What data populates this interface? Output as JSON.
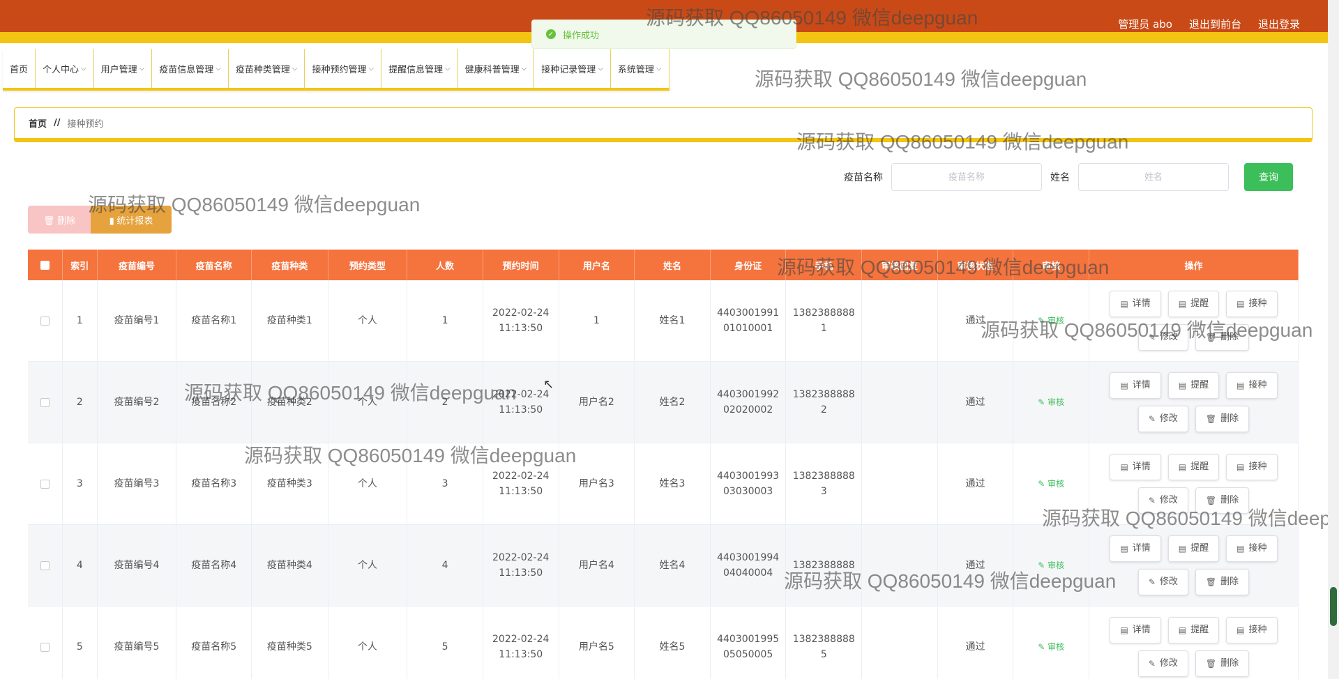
{
  "header": {
    "admin": "管理员 abo",
    "exit_front": "退出到前台",
    "logout": "退出登录"
  },
  "toast": {
    "message": "操作成功"
  },
  "nav": [
    {
      "label": "首页",
      "dropdown": false
    },
    {
      "label": "个人中心",
      "dropdown": true
    },
    {
      "label": "用户管理",
      "dropdown": true
    },
    {
      "label": "疫苗信息管理",
      "dropdown": true
    },
    {
      "label": "疫苗种类管理",
      "dropdown": true
    },
    {
      "label": "接种预约管理",
      "dropdown": true
    },
    {
      "label": "提醒信息管理",
      "dropdown": true
    },
    {
      "label": "健康科普管理",
      "dropdown": true
    },
    {
      "label": "接种记录管理",
      "dropdown": true
    },
    {
      "label": "系统管理",
      "dropdown": true
    }
  ],
  "breadcrumb": {
    "home": "首页",
    "sep": "//",
    "current": "接种预约"
  },
  "search": {
    "vaccine_label": "疫苗名称",
    "vaccine_placeholder": "疫苗名称",
    "name_label": "姓名",
    "name_placeholder": "姓名",
    "query": "查询"
  },
  "actions": {
    "delete": "删除",
    "report": "统计报表"
  },
  "table": {
    "headers": [
      "",
      "索引",
      "疫苗编号",
      "疫苗名称",
      "疫苗种类",
      "预约类型",
      "人数",
      "预约时间",
      "用户名",
      "姓名",
      "身份证",
      "手机",
      "审核回复",
      "审核状态",
      "审核",
      "操作"
    ],
    "rows": [
      {
        "idx": "1",
        "code": "疫苗编号1",
        "name": "疫苗名称1",
        "type": "疫苗种类1",
        "apptype": "个人",
        "count": "1",
        "time": "2022-02-24\n11:13:50",
        "user": "1",
        "realname": "姓名1",
        "idcard": "4403001991\n01010001",
        "phone": "1382388888\n1",
        "reply": "",
        "status": "通过",
        "audit": "审核"
      },
      {
        "idx": "2",
        "code": "疫苗编号2",
        "name": "疫苗名称2",
        "type": "疫苗种类2",
        "apptype": "个人",
        "count": "2",
        "time": "2022-02-24\n11:13:50",
        "user": "用户名2",
        "realname": "姓名2",
        "idcard": "4403001992\n02020002",
        "phone": "1382388888\n2",
        "reply": "",
        "status": "通过",
        "audit": "审核"
      },
      {
        "idx": "3",
        "code": "疫苗编号3",
        "name": "疫苗名称3",
        "type": "疫苗种类3",
        "apptype": "个人",
        "count": "3",
        "time": "2022-02-24\n11:13:50",
        "user": "用户名3",
        "realname": "姓名3",
        "idcard": "4403001993\n03030003",
        "phone": "1382388888\n3",
        "reply": "",
        "status": "通过",
        "audit": "审核"
      },
      {
        "idx": "4",
        "code": "疫苗编号4",
        "name": "疫苗名称4",
        "type": "疫苗种类4",
        "apptype": "个人",
        "count": "4",
        "time": "2022-02-24\n11:13:50",
        "user": "用户名4",
        "realname": "姓名4",
        "idcard": "4403001994\n04040004",
        "phone": "1382388888",
        "reply": "",
        "status": "通过",
        "audit": "审核"
      },
      {
        "idx": "5",
        "code": "疫苗编号5",
        "name": "疫苗名称5",
        "type": "疫苗种类5",
        "apptype": "个人",
        "count": "5",
        "time": "2022-02-24\n11:13:50",
        "user": "用户名5",
        "realname": "姓名5",
        "idcard": "4403001995\n05050005",
        "phone": "1382388888\n5",
        "reply": "",
        "status": "通过",
        "audit": "审核"
      }
    ],
    "ops": {
      "detail": "详情",
      "remind": "提醒",
      "vaccinate": "接种",
      "edit": "修改",
      "delete": "删除"
    }
  },
  "watermark": "源码获取 QQ86050149 微信deepguan"
}
